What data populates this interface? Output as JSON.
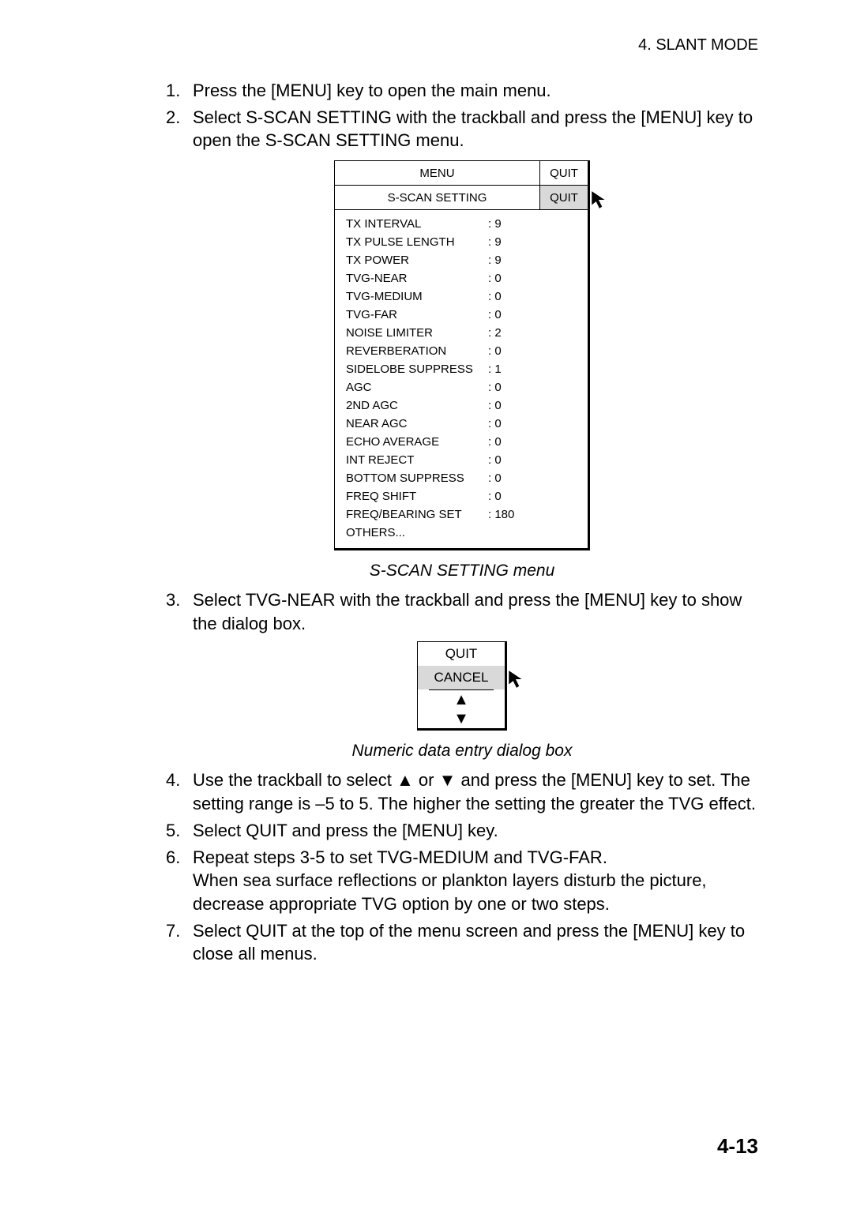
{
  "header": {
    "section": "4. SLANT MODE"
  },
  "steps": {
    "s1": {
      "num": "1.",
      "text": "Press the [MENU] key to open the main menu."
    },
    "s2": {
      "num": "2.",
      "text": "Select S-SCAN SETTING with the trackball and press the [MENU] key to open the S-SCAN SETTING menu."
    },
    "s3": {
      "num": "3.",
      "text": "Select TVG-NEAR with the trackball and press the [MENU] key to show the dialog box."
    },
    "s4": {
      "num": "4.",
      "text": "Use the trackball to select ▲ or ▼ and press the [MENU] key to set. The setting range is –5 to 5. The higher the setting the greater the TVG effect."
    },
    "s5": {
      "num": "5.",
      "text": "Select QUIT and press the [MENU] key."
    },
    "s6": {
      "num": "6.",
      "text_a": "Repeat steps 3-5 to set TVG-MEDIUM and TVG-FAR.",
      "text_b": "When sea surface reflections or plankton layers disturb the picture, decrease appropriate TVG option by one or two steps."
    },
    "s7": {
      "num": "7.",
      "text": "Select QUIT at the top of the menu screen and press the [MENU] key to close all menus."
    }
  },
  "menu": {
    "title": "MENU",
    "quit": "QUIT",
    "subtitle": "S-SCAN SETTING",
    "quit2": "QUIT",
    "items": [
      {
        "k": "TX INTERVAL",
        "v": ": 9"
      },
      {
        "k": "TX PULSE LENGTH",
        "v": ": 9"
      },
      {
        "k": "TX POWER",
        "v": ": 9"
      },
      {
        "k": "TVG-NEAR",
        "v": ": 0"
      },
      {
        "k": "TVG-MEDIUM",
        "v": ": 0"
      },
      {
        "k": "TVG-FAR",
        "v": ": 0"
      },
      {
        "k": "NOISE LIMITER",
        "v": ": 2"
      },
      {
        "k": "REVERBERATION",
        "v": ": 0"
      },
      {
        "k": "SIDELOBE SUPPRESS",
        "v": ": 1"
      },
      {
        "k": "AGC",
        "v": ": 0"
      },
      {
        "k": "2ND AGC",
        "v": ": 0"
      },
      {
        "k": "NEAR AGC",
        "v": ": 0"
      },
      {
        "k": "ECHO AVERAGE",
        "v": ": 0"
      },
      {
        "k": "INT REJECT",
        "v": ": 0"
      },
      {
        "k": "BOTTOM SUPPRESS",
        "v": ": 0"
      },
      {
        "k": "FREQ SHIFT",
        "v": ": 0"
      },
      {
        "k": "FREQ/BEARING SET",
        "v": ": 180"
      },
      {
        "k": "OTHERS...",
        "v": ""
      }
    ]
  },
  "captions": {
    "menu": "S-SCAN SETTING menu",
    "dialog": "Numeric data entry dialog box"
  },
  "dialog": {
    "quit": "QUIT",
    "cancel": "CANCEL",
    "up": "▲",
    "down": "▼"
  },
  "page": "4-13"
}
